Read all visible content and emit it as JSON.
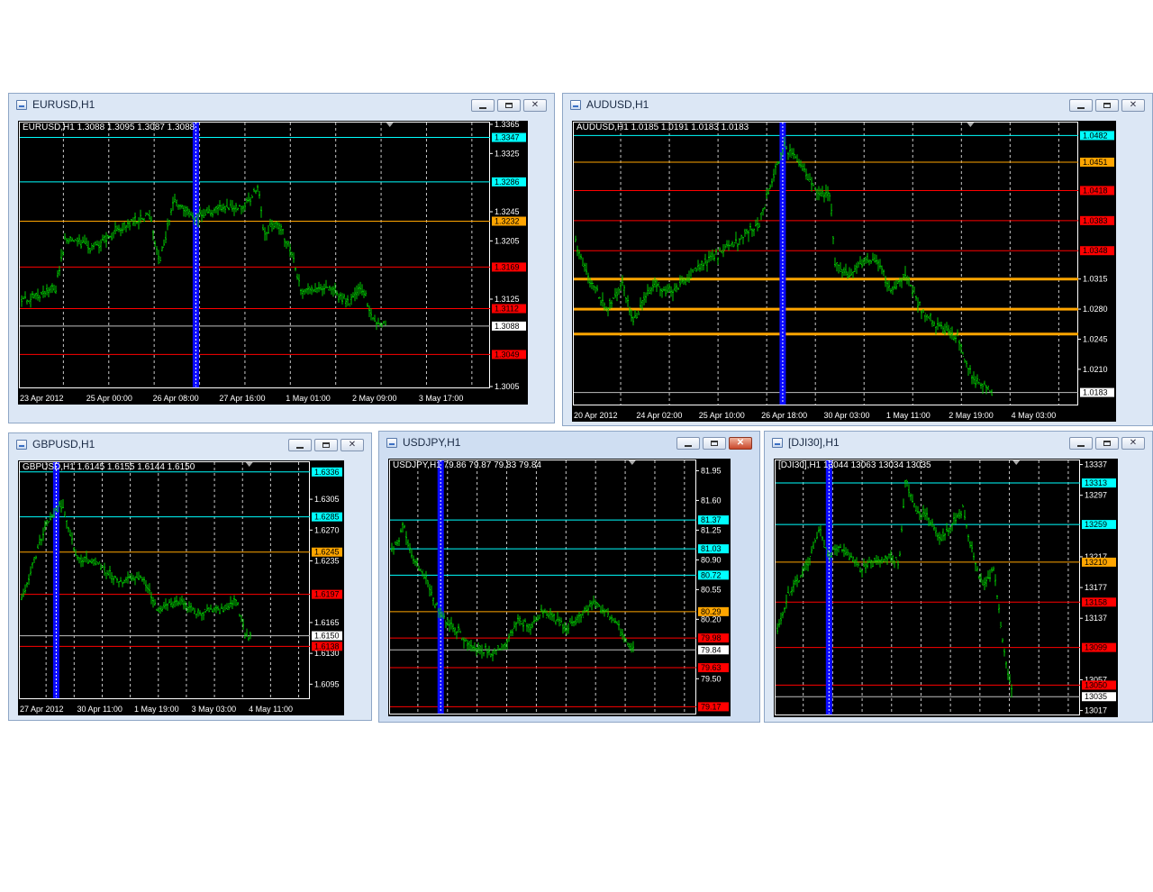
{
  "windows": [
    {
      "id": "eurusd",
      "title": "EURUSD,H1",
      "info": "EURUSD,H1  1.3088 1.3095 1.3087 1.3088",
      "active": false,
      "close_highlight": false,
      "scale": {
        "min": 1.3005,
        "max": 1.3365
      },
      "ticks": [
        {
          "label": "1.3365",
          "value": 1.3365
        },
        {
          "label": "1.3325",
          "value": 1.3325
        },
        {
          "label": "1.3245",
          "value": 1.3245
        },
        {
          "label": "1.3205",
          "value": 1.3205
        },
        {
          "label": "1.3125",
          "value": 1.3125
        },
        {
          "label": "1.3005",
          "value": 1.3005
        }
      ],
      "levels": [
        {
          "label": "1.3347",
          "value": 1.3347,
          "color": "#00ffff",
          "tag": "#00ffff",
          "tag_text": "#000000",
          "width": 1
        },
        {
          "label": "1.3286",
          "value": 1.3286,
          "color": "#00ffff",
          "tag": "#00ffff",
          "tag_text": "#000000",
          "width": 1
        },
        {
          "label": "1.3232",
          "value": 1.3232,
          "color": "#ffa500",
          "tag": "#ffa500",
          "tag_text": "#000000",
          "width": 1
        },
        {
          "label": "1.3169",
          "value": 1.3169,
          "color": "#ff0000",
          "tag": "#ff0000",
          "tag_text": "#000000",
          "width": 1
        },
        {
          "label": "1.3112",
          "value": 1.3112,
          "color": "#ff0000",
          "tag": "#ff0000",
          "tag_text": "#000000",
          "width": 1
        },
        {
          "label": "1.3088",
          "value": 1.3088,
          "color": "#c0c0c0",
          "tag": "#ffffff",
          "tag_text": "#000000",
          "width": 1
        },
        {
          "label": "1.3049",
          "value": 1.3049,
          "color": "#ff0000",
          "tag": "#ff0000",
          "tag_text": "#000000",
          "width": 1
        }
      ],
      "dates": [
        "23 Apr 2012",
        "25 Apr 00:00",
        "26 Apr 08:00",
        "27 Apr 16:00",
        "1 May 01:00",
        "2 May 09:00",
        "3 May 17:00"
      ],
      "marker": 0.37,
      "series_end": 0.78,
      "price_keys": [
        [
          0,
          1.312
        ],
        [
          0.08,
          1.314
        ],
        [
          0.1,
          1.321
        ],
        [
          0.16,
          1.3195
        ],
        [
          0.22,
          1.3225
        ],
        [
          0.28,
          1.324
        ],
        [
          0.3,
          1.3175
        ],
        [
          0.33,
          1.326
        ],
        [
          0.37,
          1.3235
        ],
        [
          0.43,
          1.325
        ],
        [
          0.48,
          1.325
        ],
        [
          0.51,
          1.328
        ],
        [
          0.52,
          1.3215
        ],
        [
          0.55,
          1.323
        ],
        [
          0.58,
          1.319
        ],
        [
          0.6,
          1.3135
        ],
        [
          0.66,
          1.314
        ],
        [
          0.7,
          1.312
        ],
        [
          0.73,
          1.314
        ],
        [
          0.75,
          1.31
        ],
        [
          0.78,
          1.3088
        ]
      ]
    },
    {
      "id": "audusd",
      "title": "AUDUSD,H1",
      "info": "AUDUSD,H1  1.0185 1.0191 1.0183 1.0183",
      "active": false,
      "close_highlight": false,
      "scale": {
        "min": 1.017,
        "max": 1.0495
      },
      "ticks": [
        {
          "label": "1.0315",
          "value": 1.0315
        },
        {
          "label": "1.0280",
          "value": 1.028
        },
        {
          "label": "1.0245",
          "value": 1.0245
        },
        {
          "label": "1.0210",
          "value": 1.021
        }
      ],
      "levels": [
        {
          "label": "1.0482",
          "value": 1.0482,
          "color": "#00ffff",
          "tag": "#00ffff",
          "tag_text": "#000000",
          "width": 1
        },
        {
          "label": "1.0451",
          "value": 1.0451,
          "color": "#ffa500",
          "tag": "#ffa500",
          "tag_text": "#000000",
          "width": 1
        },
        {
          "label": "1.0418",
          "value": 1.0418,
          "color": "#ff0000",
          "tag": "#ff0000",
          "tag_text": "#000000",
          "width": 1
        },
        {
          "label": "1.0383",
          "value": 1.0383,
          "color": "#ff0000",
          "tag": "#ff0000",
          "tag_text": "#000000",
          "width": 1
        },
        {
          "label": "1.0348",
          "value": 1.0348,
          "color": "#ff0000",
          "tag": "#ff0000",
          "tag_text": "#000000",
          "width": 1
        },
        {
          "label": "",
          "value": 1.0315,
          "color": "#ffa500",
          "tag": "",
          "tag_text": "#000000",
          "width": 3
        },
        {
          "label": "",
          "value": 1.028,
          "color": "#ffa500",
          "tag": "",
          "tag_text": "#000000",
          "width": 3
        },
        {
          "label": "",
          "value": 1.0251,
          "color": "#ffa500",
          "tag": "",
          "tag_text": "#000000",
          "width": 3
        },
        {
          "label": "1.0183",
          "value": 1.0183,
          "color": "#c0c0c0",
          "tag": "#ffffff",
          "tag_text": "#000000",
          "width": 1
        }
      ],
      "dates": [
        "20 Apr 2012",
        "24 Apr 02:00",
        "25 Apr 10:00",
        "26 Apr 18:00",
        "30 Apr 03:00",
        "1 May 11:00",
        "2 May 19:00",
        "4 May 03:00"
      ],
      "marker": 0.41,
      "series_end": 0.83,
      "price_keys": [
        [
          0,
          1.037
        ],
        [
          0.03,
          1.032
        ],
        [
          0.07,
          1.028
        ],
        [
          0.1,
          1.031
        ],
        [
          0.12,
          1.0265
        ],
        [
          0.16,
          1.031
        ],
        [
          0.2,
          1.03
        ],
        [
          0.25,
          1.033
        ],
        [
          0.28,
          1.034
        ],
        [
          0.33,
          1.036
        ],
        [
          0.37,
          1.038
        ],
        [
          0.4,
          1.044
        ],
        [
          0.42,
          1.047
        ],
        [
          0.45,
          1.045
        ],
        [
          0.48,
          1.042
        ],
        [
          0.51,
          1.041
        ],
        [
          0.52,
          1.033
        ],
        [
          0.55,
          1.032
        ],
        [
          0.58,
          1.034
        ],
        [
          0.61,
          1.033
        ],
        [
          0.63,
          1.03
        ],
        [
          0.66,
          1.032
        ],
        [
          0.69,
          1.028
        ],
        [
          0.72,
          1.026
        ],
        [
          0.76,
          1.025
        ],
        [
          0.79,
          1.02
        ],
        [
          0.83,
          1.0183
        ]
      ]
    },
    {
      "id": "gbpusd",
      "title": "GBPUSD,H1",
      "info": "GBPUSD,H1  1.6145 1.6155 1.6144 1.6150",
      "active": false,
      "close_highlight": false,
      "scale": {
        "min": 1.608,
        "max": 1.6345
      },
      "ticks": [
        {
          "label": "1.6305",
          "value": 1.6305
        },
        {
          "label": "1.6270",
          "value": 1.627
        },
        {
          "label": "1.6235",
          "value": 1.6235
        },
        {
          "label": "1.6165",
          "value": 1.6165
        },
        {
          "label": "1.6130",
          "value": 1.613
        },
        {
          "label": "1.6095",
          "value": 1.6095
        }
      ],
      "levels": [
        {
          "label": "1.6336",
          "value": 1.6336,
          "color": "#00ffff",
          "tag": "#00ffff",
          "tag_text": "#000000",
          "width": 1
        },
        {
          "label": "1.6285",
          "value": 1.6285,
          "color": "#00ffff",
          "tag": "#00ffff",
          "tag_text": "#000000",
          "width": 1
        },
        {
          "label": "1.6245",
          "value": 1.6245,
          "color": "#ffa500",
          "tag": "#ffa500",
          "tag_text": "#000000",
          "width": 1
        },
        {
          "label": "1.6197",
          "value": 1.6197,
          "color": "#ff0000",
          "tag": "#ff0000",
          "tag_text": "#000000",
          "width": 1
        },
        {
          "label": "1.6150",
          "value": 1.615,
          "color": "#c0c0c0",
          "tag": "#ffffff",
          "tag_text": "#000000",
          "width": 1
        },
        {
          "label": "1.6138",
          "value": 1.6138,
          "color": "#ff0000",
          "tag": "#ff0000",
          "tag_text": "#000000",
          "width": 1
        }
      ],
      "dates": [
        "27 Apr 2012",
        "30 Apr 11:00",
        "1 May 19:00",
        "3 May 03:00",
        "4 May 11:00"
      ],
      "marker": 0.12,
      "series_end": 0.8,
      "price_keys": [
        [
          0,
          1.618
        ],
        [
          0.05,
          1.623
        ],
        [
          0.1,
          1.628
        ],
        [
          0.15,
          1.63
        ],
        [
          0.2,
          1.624
        ],
        [
          0.28,
          1.623
        ],
        [
          0.35,
          1.621
        ],
        [
          0.42,
          1.622
        ],
        [
          0.48,
          1.618
        ],
        [
          0.55,
          1.619
        ],
        [
          0.62,
          1.6175
        ],
        [
          0.7,
          1.618
        ],
        [
          0.75,
          1.619
        ],
        [
          0.78,
          1.615
        ],
        [
          0.8,
          1.615
        ]
      ]
    },
    {
      "id": "usdjpy",
      "title": "USDJPY,H1",
      "info": "USDJPY,H1  79.86 79.87 79.83 79.84",
      "active": true,
      "close_highlight": true,
      "scale": {
        "min": 79.1,
        "max": 82.05
      },
      "ticks": [
        {
          "label": "81.95",
          "value": 81.95
        },
        {
          "label": "81.60",
          "value": 81.6
        },
        {
          "label": "81.25",
          "value": 81.25
        },
        {
          "label": "80.90",
          "value": 80.9
        },
        {
          "label": "80.55",
          "value": 80.55
        },
        {
          "label": "80.20",
          "value": 80.2
        },
        {
          "label": "79.50",
          "value": 79.5
        }
      ],
      "levels": [
        {
          "label": "81.37",
          "value": 81.37,
          "color": "#00ffff",
          "tag": "#00ffff",
          "tag_text": "#000000",
          "width": 1
        },
        {
          "label": "81.03",
          "value": 81.03,
          "color": "#00ffff",
          "tag": "#00ffff",
          "tag_text": "#000000",
          "width": 1
        },
        {
          "label": "80.72",
          "value": 80.72,
          "color": "#00ffff",
          "tag": "#00ffff",
          "tag_text": "#000000",
          "width": 1
        },
        {
          "label": "80.29",
          "value": 80.29,
          "color": "#ffa500",
          "tag": "#ffa500",
          "tag_text": "#000000",
          "width": 1
        },
        {
          "label": "79.98",
          "value": 79.98,
          "color": "#ff0000",
          "tag": "#ff0000",
          "tag_text": "#000000",
          "width": 1
        },
        {
          "label": "79.84",
          "value": 79.84,
          "color": "#c0c0c0",
          "tag": "#ffffff",
          "tag_text": "#000000",
          "width": 1
        },
        {
          "label": "79.63",
          "value": 79.63,
          "color": "#ff0000",
          "tag": "#ff0000",
          "tag_text": "#000000",
          "width": 1
        },
        {
          "label": "79.17",
          "value": 79.17,
          "color": "#ff0000",
          "tag": "#ff0000",
          "tag_text": "#000000",
          "width": 1
        }
      ],
      "dates": [],
      "marker": 0.16,
      "series_end": 0.8,
      "price_keys": [
        [
          0,
          81.0
        ],
        [
          0.03,
          81.1
        ],
        [
          0.05,
          81.3
        ],
        [
          0.08,
          80.9
        ],
        [
          0.12,
          80.7
        ],
        [
          0.15,
          80.4
        ],
        [
          0.18,
          80.2
        ],
        [
          0.22,
          80.1
        ],
        [
          0.26,
          79.9
        ],
        [
          0.3,
          79.85
        ],
        [
          0.34,
          79.8
        ],
        [
          0.38,
          79.9
        ],
        [
          0.42,
          80.2
        ],
        [
          0.46,
          80.1
        ],
        [
          0.5,
          80.3
        ],
        [
          0.54,
          80.2
        ],
        [
          0.58,
          80.1
        ],
        [
          0.62,
          80.2
        ],
        [
          0.66,
          80.4
        ],
        [
          0.7,
          80.3
        ],
        [
          0.74,
          80.15
        ],
        [
          0.78,
          79.9
        ],
        [
          0.8,
          79.84
        ]
      ]
    },
    {
      "id": "dji30",
      "title": "[DJI30],H1",
      "info": "[DJI30],H1  13044 13063 13034 13035",
      "active": false,
      "close_highlight": false,
      "scale": {
        "min": 13013,
        "max": 13340
      },
      "ticks": [
        {
          "label": "13337",
          "value": 13337
        },
        {
          "label": "13297",
          "value": 13297
        },
        {
          "label": "13217",
          "value": 13217
        },
        {
          "label": "13177",
          "value": 13177
        },
        {
          "label": "13137",
          "value": 13137
        },
        {
          "label": "13057",
          "value": 13057
        },
        {
          "label": "13017",
          "value": 13017
        }
      ],
      "levels": [
        {
          "label": "13313",
          "value": 13313,
          "color": "#00ffff",
          "tag": "#00ffff",
          "tag_text": "#000000",
          "width": 1
        },
        {
          "label": "13259",
          "value": 13259,
          "color": "#00ffff",
          "tag": "#00ffff",
          "tag_text": "#000000",
          "width": 1
        },
        {
          "label": "13210",
          "value": 13210,
          "color": "#ffa500",
          "tag": "#ffa500",
          "tag_text": "#000000",
          "width": 1
        },
        {
          "label": "13158",
          "value": 13158,
          "color": "#ff0000",
          "tag": "#ff0000",
          "tag_text": "#000000",
          "width": 1
        },
        {
          "label": "13099",
          "value": 13099,
          "color": "#ff0000",
          "tag": "#ff0000",
          "tag_text": "#000000",
          "width": 1
        },
        {
          "label": "13050",
          "value": 13050,
          "color": "#ff0000",
          "tag": "#ff0000",
          "tag_text": "#000000",
          "width": 1
        },
        {
          "label": "13035",
          "value": 13035,
          "color": "#c0c0c0",
          "tag": "#ffffff",
          "tag_text": "#000000",
          "width": 1
        }
      ],
      "dates": [],
      "marker": 0.17,
      "series_end": 0.78,
      "price_keys": [
        [
          0,
          13110
        ],
        [
          0.05,
          13170
        ],
        [
          0.1,
          13200
        ],
        [
          0.15,
          13250
        ],
        [
          0.18,
          13220
        ],
        [
          0.22,
          13230
        ],
        [
          0.28,
          13200
        ],
        [
          0.33,
          13210
        ],
        [
          0.38,
          13220
        ],
        [
          0.41,
          13210
        ],
        [
          0.43,
          13320
        ],
        [
          0.46,
          13280
        ],
        [
          0.5,
          13270
        ],
        [
          0.54,
          13240
        ],
        [
          0.58,
          13260
        ],
        [
          0.62,
          13280
        ],
        [
          0.65,
          13220
        ],
        [
          0.68,
          13180
        ],
        [
          0.72,
          13200
        ],
        [
          0.75,
          13100
        ],
        [
          0.78,
          13035
        ]
      ]
    }
  ]
}
